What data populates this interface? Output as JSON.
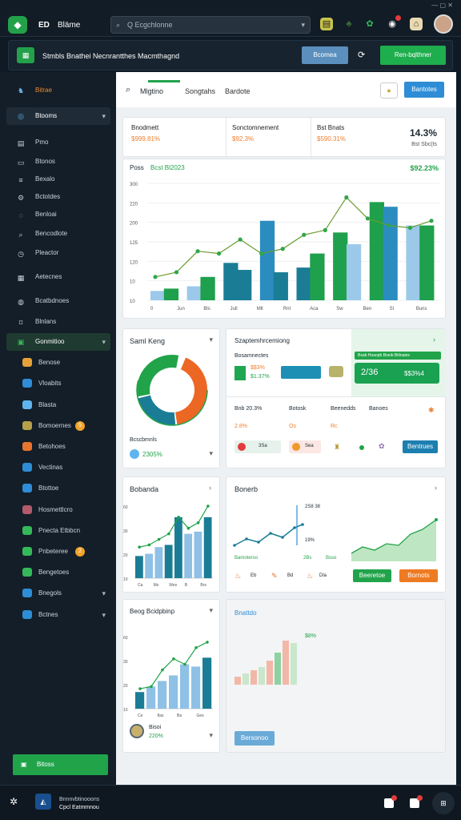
{
  "topbar": {
    "logo": "◆",
    "brand": "ED",
    "brand_sub": "Bläme",
    "search_placeholder": "Q Ecgchlonne"
  },
  "header": {
    "title": "Stmbls Bnathei Necnrantthes Macmthagnd",
    "btn_secondary": "Bcomea",
    "btn_primary": "Ren-bqlthner"
  },
  "sidebar": {
    "top": "Bitrae",
    "section": "Btooms",
    "items": [
      {
        "label": "Pmo",
        "icon": "doc-icon"
      },
      {
        "label": "Btonos",
        "icon": "folder-icon"
      },
      {
        "label": "Bexalo",
        "icon": "list-icon"
      },
      {
        "label": "Bctotdes",
        "icon": "gear-icon"
      },
      {
        "label": "Benloai",
        "icon": "chat-icon"
      },
      {
        "label": "Bencodlote",
        "icon": "search-icon"
      },
      {
        "label": "Pleactor",
        "icon": "clock-icon"
      },
      {
        "label": "Aetecnes",
        "icon": "calendar-icon"
      },
      {
        "label": "Bcatbdnoes",
        "icon": "user-icon"
      },
      {
        "label": "Blnlans",
        "icon": "tag-icon"
      },
      {
        "label": "Bensfndo",
        "icon": "grid-icon"
      }
    ],
    "sub": [
      {
        "label": "Gonmitioo",
        "badge": ""
      },
      {
        "label": "Benose",
        "badge": ""
      },
      {
        "label": "Vloabits",
        "badge": ""
      },
      {
        "label": "Blasta",
        "badge": ""
      },
      {
        "label": "Bomoernes",
        "badge": "5"
      },
      {
        "label": "Betohoes",
        "badge": ""
      },
      {
        "label": "Vectinas",
        "badge": ""
      },
      {
        "label": "Btottoe",
        "badge": ""
      },
      {
        "label": "Hosmettlcro",
        "badge": ""
      },
      {
        "label": "Pnecta Etbbcn",
        "badge": ""
      },
      {
        "label": "Pnbeteree",
        "badge": "2"
      },
      {
        "label": "Bengetoes",
        "badge": ""
      },
      {
        "label": "Bnegols",
        "badge": ""
      },
      {
        "label": "Bctnes",
        "badge": ""
      }
    ],
    "footer_btn": "Bitoss"
  },
  "tabs": [
    "Mlgtino",
    "Songtahs",
    "Bardote"
  ],
  "tab_btn": "Bantotes",
  "kpis": [
    {
      "label": "Bnodmett",
      "value": "$999.81%"
    },
    {
      "label": "Sonctomnement",
      "value": "$92.3%"
    },
    {
      "label": "Bst Bnats",
      "value": "$590.31%"
    }
  ],
  "kpi_right": {
    "value": "14.3%",
    "sub": "Bst Sbc(ts"
  },
  "main_chart": {
    "title": "Poss",
    "subtitle": "Bcst Bl2023",
    "total": "$92.23%"
  },
  "chart_data": {
    "type": "bar",
    "categories": [
      "Jan",
      "Feb",
      "Mar",
      "Apr",
      "May",
      "Jun",
      "Jul",
      "Aug",
      "Sep",
      "Oct",
      "Nov",
      "Dec"
    ],
    "ylim": [
      0,
      250
    ],
    "yticks": [
      "300",
      "220",
      "200",
      "125",
      "120",
      "10",
      "10"
    ],
    "series": [
      {
        "values": [
          20,
          38,
          0,
          52,
          0,
          78,
          58,
          0,
          0,
          0,
          40,
          130
        ],
        "color": "#86bde6"
      },
      {
        "values": [
          0,
          0,
          0,
          0,
          0,
          0,
          0,
          0,
          0,
          115,
          0,
          0
        ],
        "color": "#2b8cbf"
      },
      {
        "values": [
          0,
          0,
          0,
          0,
          0,
          0,
          0,
          0,
          0,
          0,
          0,
          0
        ],
        "color": "#1b7d95"
      },
      {
        "values": [
          25,
          0,
          50,
          60,
          145,
          50,
          0,
          0,
          92,
          0,
          175,
          120
        ],
        "color": "#1ea04c"
      }
    ],
    "bars": [
      {
        "v": 20,
        "c": "#9cc9ea"
      },
      {
        "v": 25,
        "c": "#1ea04c"
      },
      {
        "v": 30,
        "c": "#9cc9ea"
      },
      {
        "v": 50,
        "c": "#1ea04c"
      },
      {
        "v": 80,
        "c": "#1b7d95"
      },
      {
        "v": 65,
        "c": "#1b7d95"
      },
      {
        "v": 170,
        "c": "#2b8cbf"
      },
      {
        "v": 60,
        "c": "#1b7d95"
      },
      {
        "v": 70,
        "c": "#1b7d95"
      },
      {
        "v": 100,
        "c": "#1ea04c"
      },
      {
        "v": 145,
        "c": "#1ea04c"
      },
      {
        "v": 120,
        "c": "#9cc9ea"
      },
      {
        "v": 210,
        "c": "#1ea04c"
      },
      {
        "v": 200,
        "c": "#2b8cbf"
      },
      {
        "v": 160,
        "c": "#9cc9ea"
      },
      {
        "v": 160,
        "c": "#1ea04c"
      }
    ],
    "line": [
      50,
      60,
      105,
      100,
      130,
      100,
      110,
      140,
      150,
      220,
      175,
      160,
      155,
      170
    ],
    "xlabels": [
      "0",
      "Jun",
      "Bls",
      "Jull",
      "Mlt",
      "Rnl",
      "Aca",
      "Sw",
      "Ben",
      "Sl",
      "Buns"
    ]
  },
  "donut": {
    "title": "Saml Keng",
    "pct": "2305%",
    "label": "Bcscbmnls",
    "slices": [
      {
        "v": 40,
        "c": "#ec6724"
      },
      {
        "v": 22,
        "c": "#1b7d95"
      },
      {
        "v": 30,
        "c": "#21a34a"
      }
    ]
  },
  "cards_mid": {
    "title": "Szaptemhrcemiong",
    "sub": "Bosamnectes",
    "green_title": "Bsab Hoaopb Boeib Bitlnates",
    "green_val": "2/36",
    "green_val2": "$$3%4",
    "row1_val1": "$$3%",
    "row1_val2": "$1.37%",
    "row2": [
      {
        "label": "Bnb 20.3%",
        "val": "2.8%"
      },
      {
        "label": "Botosk",
        "val": "Os"
      },
      {
        "label": "Beenedds",
        "val": "Rc"
      },
      {
        "label": "Banoes",
        "val": ""
      }
    ],
    "row3_pills": [
      "3Sa",
      "Sea"
    ],
    "btn": "Bentrues"
  },
  "line_card": {
    "title": "Bonerb",
    "v1": "2S8 38",
    "v2": "19%",
    "legend": [
      "Bamoterso",
      "2Bs",
      "Bsso"
    ],
    "items": [
      "Eb",
      "Bd",
      "Dla"
    ],
    "btn1": "Beeretoe",
    "btn2": "Bornots"
  },
  "bar_card1": {
    "title": "Bobanda",
    "bars": [
      {
        "v": 20,
        "c": "#1b7d95"
      },
      {
        "v": 22,
        "c": "#8fc0e6"
      },
      {
        "v": 28,
        "c": "#8fc0e6"
      },
      {
        "v": 30,
        "c": "#1b7d95"
      },
      {
        "v": 55,
        "c": "#1b7d95"
      },
      {
        "v": 40,
        "c": "#8fc0e6"
      },
      {
        "v": 42,
        "c": "#8fc0e6"
      },
      {
        "v": 55,
        "c": "#1b7d95"
      }
    ],
    "line": [
      28,
      30,
      35,
      40,
      55,
      45,
      50,
      65
    ],
    "xl": [
      "Ca",
      "Ms",
      "Wes",
      "B",
      "Brs"
    ]
  },
  "bar_card2": {
    "title": "Beog Bcidpbinp",
    "bars": [
      {
        "v": 15,
        "c": "#1b7d95"
      },
      {
        "v": 20,
        "c": "#8fc0e6"
      },
      {
        "v": 25,
        "c": "#8fc0e6"
      },
      {
        "v": 30,
        "c": "#8fc0e6"
      },
      {
        "v": 40,
        "c": "#8fc0e6"
      },
      {
        "v": 38,
        "c": "#8fc0e6"
      },
      {
        "v": 46,
        "c": "#1b7d95"
      }
    ],
    "line": [
      18,
      20,
      35,
      45,
      40,
      55,
      60
    ],
    "xl": [
      "Ce",
      "8as",
      "Ba",
      "Ges"
    ],
    "foot_label": "Bisoi",
    "foot_val": "220%"
  },
  "area_card": {
    "title": "Bnattdo",
    "green_val": "$8%",
    "bars": [
      {
        "v": 10,
        "c": "#f3b7a7"
      },
      {
        "v": 14,
        "c": "#c9e7cb"
      },
      {
        "v": 18,
        "c": "#f3b7a7"
      },
      {
        "v": 22,
        "c": "#c9e7cb"
      },
      {
        "v": 30,
        "c": "#f3b7a7"
      },
      {
        "v": 40,
        "c": "#8fd1a0"
      },
      {
        "v": 55,
        "c": "#f3b7a7"
      },
      {
        "v": 52,
        "c": "#c9e7cb"
      }
    ],
    "btn": "Bersonoo"
  },
  "bottom": {
    "title": "Bnnnvbtinooons",
    "subtitle": "Cpcl Eatmmnou"
  }
}
